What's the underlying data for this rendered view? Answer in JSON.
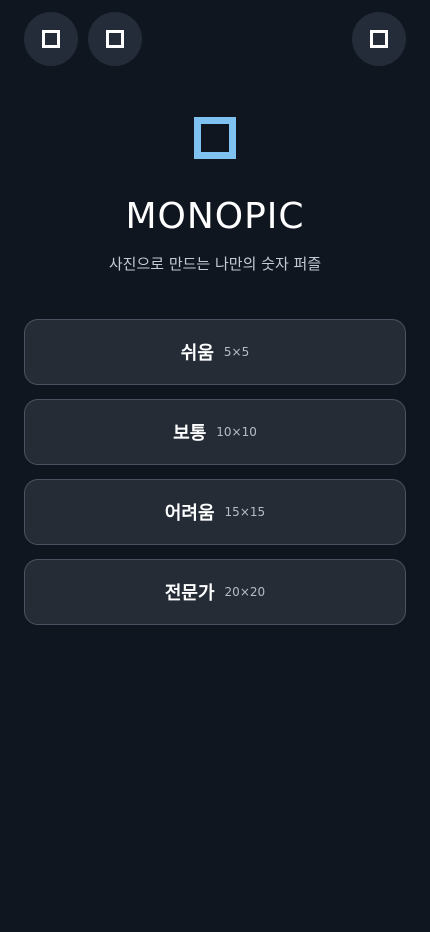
{
  "header": {
    "buttons": [
      {
        "icon": "square-icon"
      },
      {
        "icon": "square-icon"
      },
      {
        "icon": "square-icon"
      }
    ]
  },
  "brand": {
    "logo_icon": "square-outline-logo",
    "logo_color": "#7fc2f2",
    "title": "MONOPIC",
    "subtitle": "사진으로 만드는 나만의 숫자 퍼즐"
  },
  "levels": [
    {
      "name": "쉬움",
      "size": "5×5"
    },
    {
      "name": "보통",
      "size": "10×10"
    },
    {
      "name": "어려움",
      "size": "15×15"
    },
    {
      "name": "전문가",
      "size": "20×20"
    }
  ],
  "colors": {
    "background": "#0f161f",
    "card": "#252c36",
    "card_border": "#4a5361",
    "accent": "#7fc2f2"
  }
}
